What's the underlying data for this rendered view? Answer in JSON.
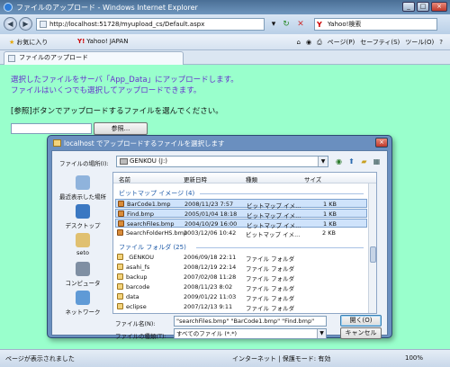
{
  "window": {
    "title": "ファイルのアップロード - Windows Internet Explorer",
    "url": "http://localhost:51728/myupload_cs/Default.aspx",
    "search_engine": "Yahoo!検索"
  },
  "favorites": {
    "favorites_label": "お気に入り",
    "yahoo_label": "Yahoo! JAPAN"
  },
  "toolbar": {
    "page_label": "ページ(P)",
    "safety_label": "セーフティ(S)",
    "tools_label": "ツール(O)",
    "help_label": "?"
  },
  "tab": {
    "title": "ファイルのアップロード"
  },
  "page": {
    "message_line1": "選択したファイルをサーバ「App_Data」にアップロードします。",
    "message_line2": "ファイルはいくつでも選択してアップロードできます。",
    "instruction": "[参照]ボタンでアップロードするファイルを選んでください。",
    "browse_label": "参照..."
  },
  "status": {
    "text": "ページが表示されました",
    "zone": "インターネット | 保護モード: 有効",
    "zoom": "100%"
  },
  "dialog": {
    "title": "localhost でアップロードするファイルを選択します",
    "look_in_label": "ファイルの場所(I):",
    "look_in_value": "GENKOU (J:)",
    "places": [
      "最近表示した場所",
      "デスクトップ",
      "seto",
      "コンピュータ",
      "ネットワーク"
    ],
    "columns": [
      "名前",
      "更新日時",
      "種類",
      "サイズ"
    ],
    "group_bitmap": "ビットマップ イメージ (4)",
    "group_folder": "ファイル フォルダ (25)",
    "bitmap_files": [
      {
        "name": "BarCode1.bmp",
        "date": "2008/11/23 7:57",
        "type": "ビットマップ イメ...",
        "size": "1 KB"
      },
      {
        "name": "Find.bmp",
        "date": "2005/01/04 18:18",
        "type": "ビットマップ イメ...",
        "size": "1 KB"
      },
      {
        "name": "searchFiles.bmp",
        "date": "2004/10/29 16:00",
        "type": "ビットマップ イメ...",
        "size": "1 KB"
      },
      {
        "name": "SearchFolderHS.bmp",
        "date": "2003/12/06 10:42",
        "type": "ビットマップ イメ...",
        "size": "2 KB"
      }
    ],
    "folders": [
      {
        "name": "_GENKOU",
        "date": "2006/09/18 22:11",
        "type": "ファイル フォルダ"
      },
      {
        "name": "asahi_fs",
        "date": "2008/12/19 22:14",
        "type": "ファイル フォルダ"
      },
      {
        "name": "backup",
        "date": "2007/02/08 11:28",
        "type": "ファイル フォルダ"
      },
      {
        "name": "barcode",
        "date": "2008/11/23 8:02",
        "type": "ファイル フォルダ"
      },
      {
        "name": "data",
        "date": "2009/01/22 11:03",
        "type": "ファイル フォルダ"
      },
      {
        "name": "eclipse",
        "date": "2007/12/13 9:11",
        "type": "ファイル フォルダ"
      }
    ],
    "filename_label": "ファイル名(N):",
    "filename_value": "\"searchFiles.bmp\" \"BarCode1.bmp\" \"Find.bmp\"",
    "filetype_label": "ファイルの種類(T):",
    "filetype_value": "すべてのファイル (*.*)",
    "open_label": "開く(O)",
    "cancel_label": "キャンセル"
  }
}
